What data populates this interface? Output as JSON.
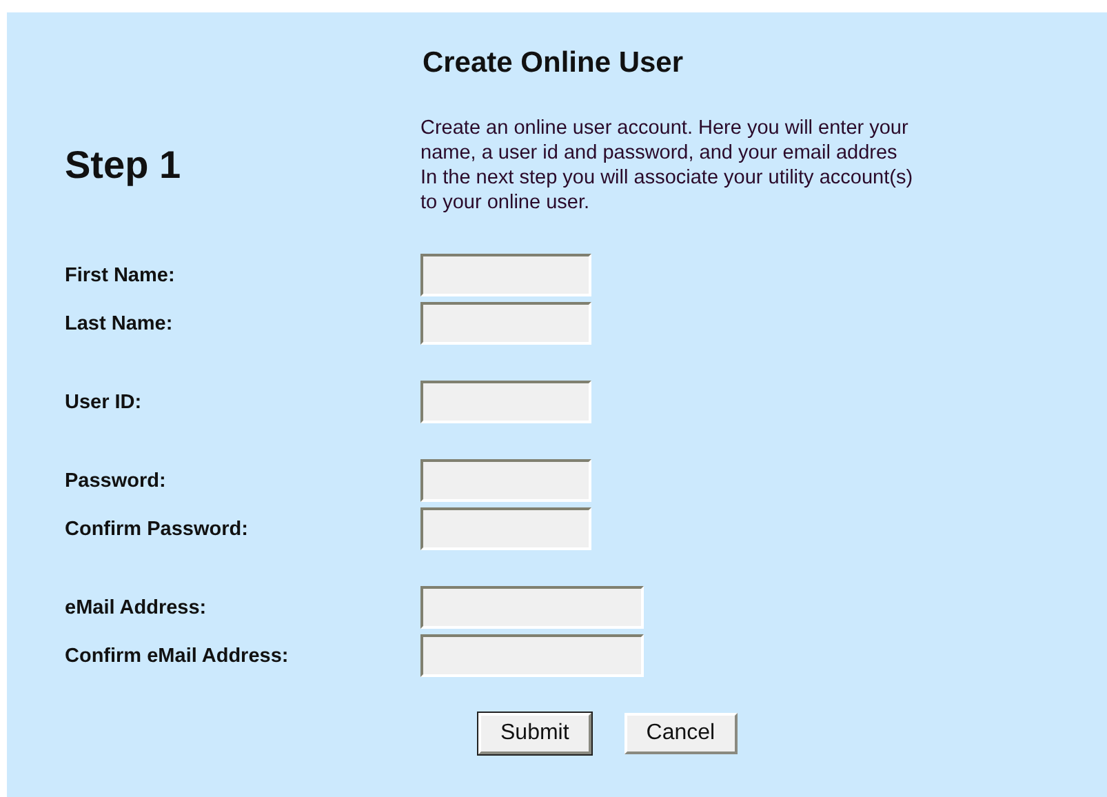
{
  "title": "Create Online User",
  "step": "Step 1",
  "description_lines": [
    "Create an online user account. Here you will enter your",
    "name, a user id and password, and your email addres",
    "In the next step you will associate your utility account(s)",
    "to your online user."
  ],
  "field_groups": [
    [
      {
        "label": "First Name:",
        "kind": "short"
      },
      {
        "label": "Last Name:",
        "kind": "short"
      }
    ],
    [
      {
        "label": "User ID:",
        "kind": "short"
      }
    ],
    [
      {
        "label": "Password:",
        "kind": "short"
      },
      {
        "label": "Confirm Password:",
        "kind": "short"
      }
    ],
    [
      {
        "label": "eMail Address:",
        "kind": "long"
      },
      {
        "label": "Confirm eMail Address:",
        "kind": "long"
      }
    ]
  ],
  "buttons": [
    {
      "label": "Submit",
      "default": true
    },
    {
      "label": "Cancel",
      "default": false
    }
  ]
}
